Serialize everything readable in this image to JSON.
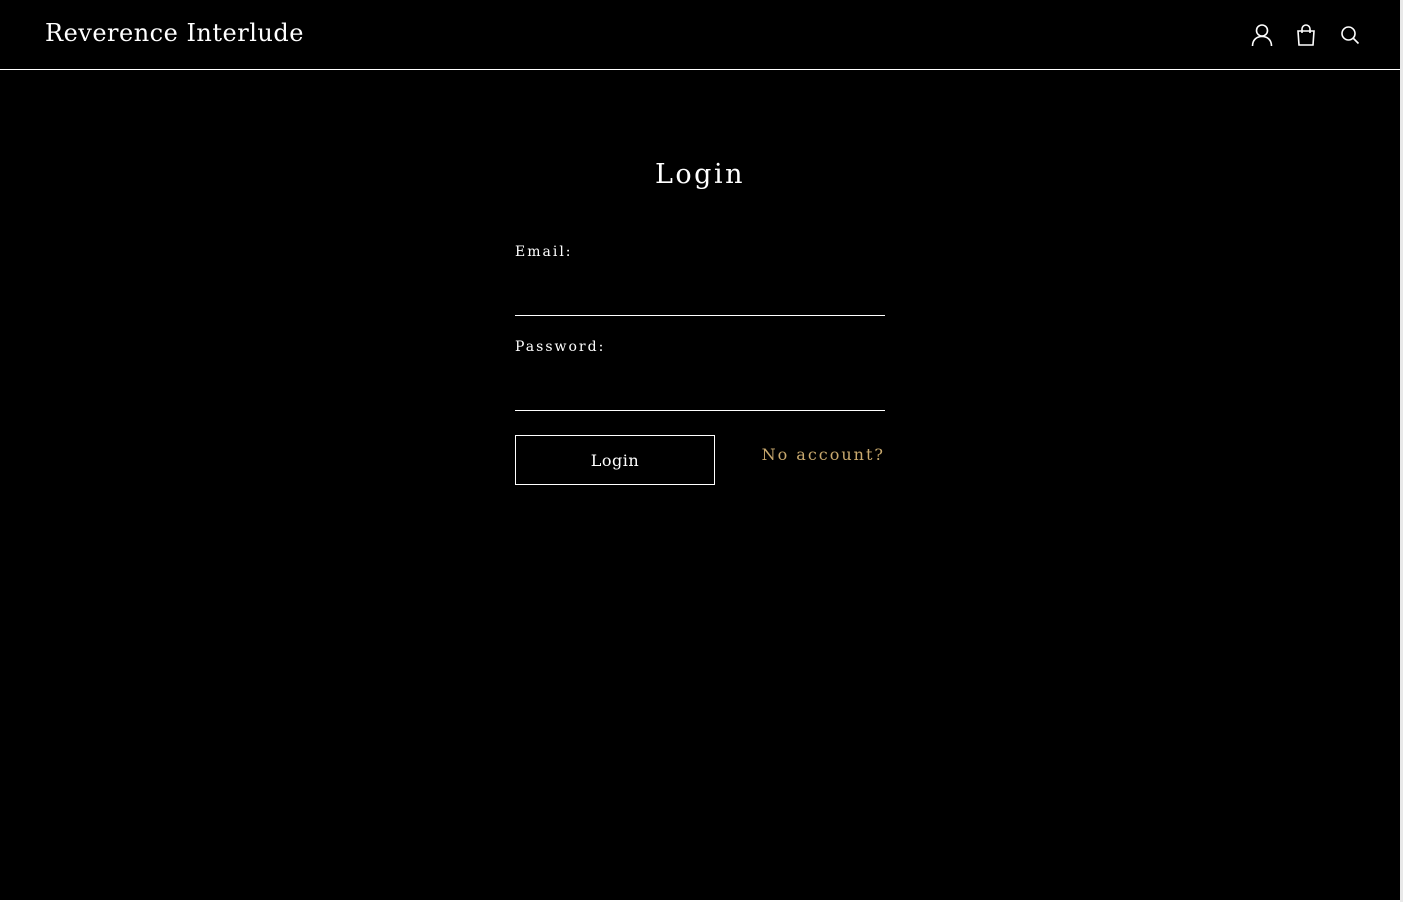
{
  "header": {
    "brand": "Reverence Interlude",
    "icons": [
      "user-icon",
      "shopping-bag-icon",
      "search-icon"
    ]
  },
  "main": {
    "title": "Login",
    "email_label": "Email:",
    "email_value": "",
    "password_label": "Password:",
    "password_value": "",
    "login_button": "Login",
    "no_account_link": "No account?"
  },
  "colors": {
    "background": "#000000",
    "text": "#ffffff",
    "accent_link": "#c9a96e"
  }
}
